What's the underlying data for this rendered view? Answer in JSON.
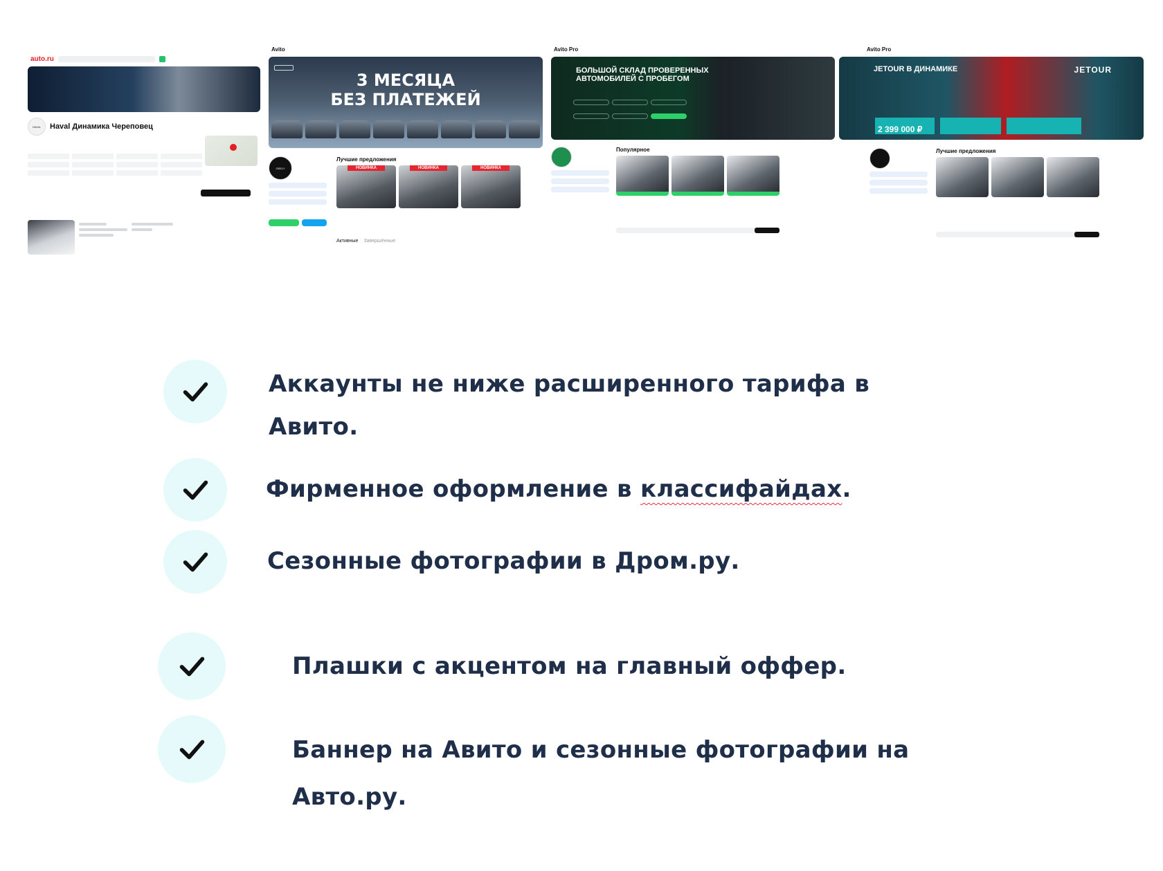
{
  "screenshots": {
    "autoru": {
      "logo": "auto.ru",
      "dealer_name": "Haval Динамика Череповец"
    },
    "avito_geely": {
      "logo": "Avito",
      "banner_line1": "3 МЕСЯЦА",
      "banner_line2": "БЕЗ ПЛАТЕЖЕЙ",
      "badge": "НОВИНКА",
      "section_title": "Лучшие предложения",
      "tab_active": "Активные",
      "tab_done": "Завершённые"
    },
    "avito_pro_used": {
      "logo": "Avito Pro",
      "banner_title": "БОЛЬШОЙ СКЛАД ПРОВЕРЕННЫХ АВТОМОБИЛЕЙ С ПРОБЕГОМ",
      "section_title": "Популярное"
    },
    "avito_pro_jetour": {
      "logo": "Avito Pro",
      "banner_title": "JETOUR В ДИНАМИКЕ",
      "brand": "JETOUR",
      "price": "2 399 000 ₽",
      "section_title": "Лучшие предложения"
    }
  },
  "checklist": [
    {
      "line1": "Аккаунты не ниже расширенного тарифа в",
      "line2": "Авито."
    },
    {
      "line1": "Фирменное оформление в ",
      "underlined": "классифайдах",
      "tail": "."
    },
    {
      "line1": "Сезонные фотографии в Дром.ру."
    },
    {
      "line1": "Плашки с акцентом на главный оффер."
    },
    {
      "line1": "Баннер на Авито и сезонные фотографии на",
      "line2": "Авто.ру."
    }
  ],
  "colors": {
    "check_circle_bg": "#e6fafb",
    "text": "#1f2f4a",
    "accent_red": "#e31e24",
    "accent_green": "#2fd06a"
  },
  "icons": {
    "check": "checkmark-icon"
  }
}
